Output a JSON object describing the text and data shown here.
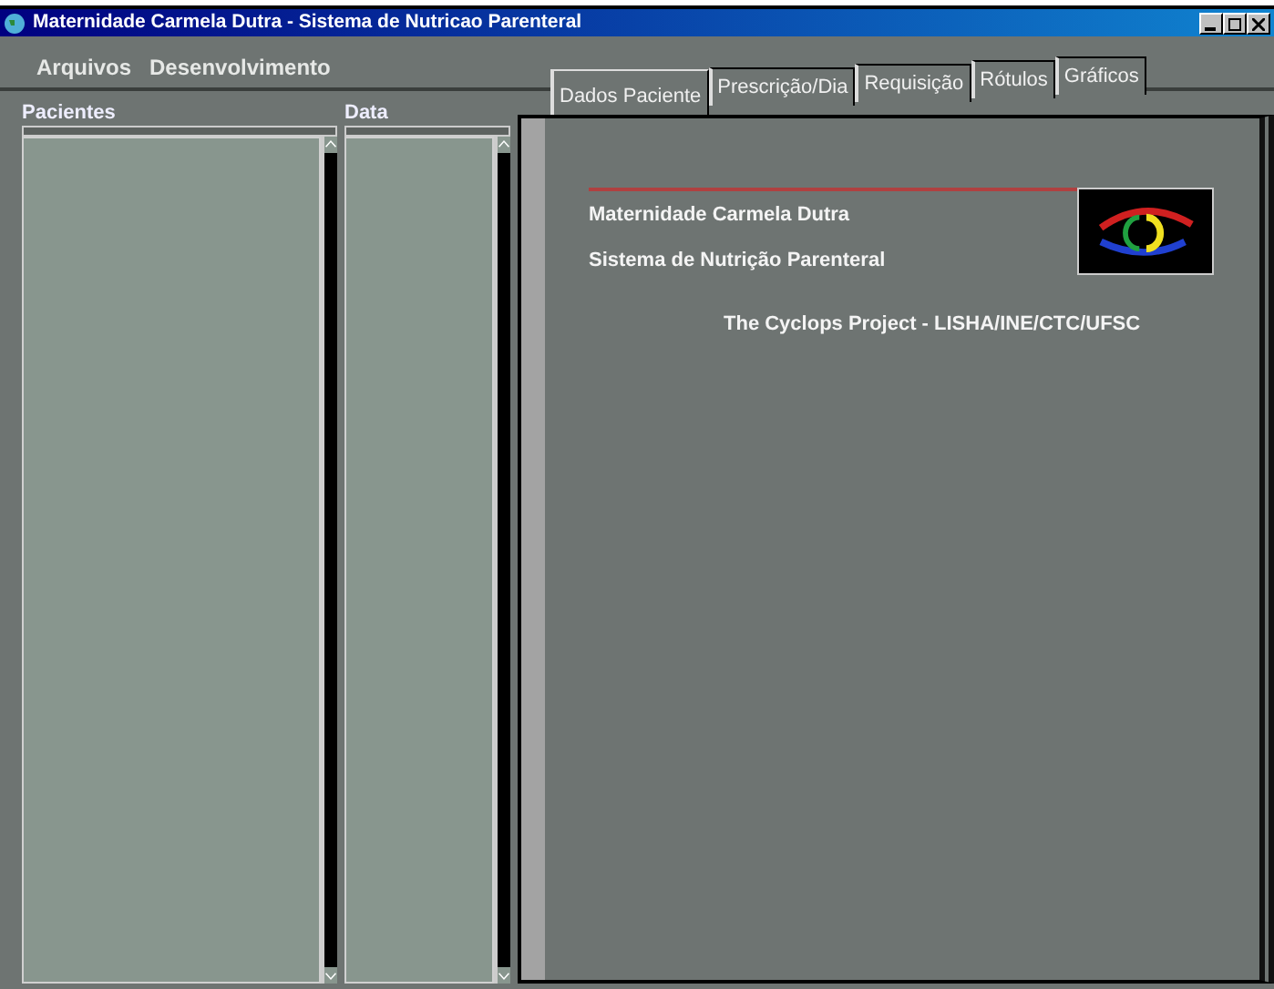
{
  "window": {
    "title": "Maternidade Carmela Dutra - Sistema de Nutricao Parenteral"
  },
  "menu": [
    "Arquivos",
    "Desenvolvimento"
  ],
  "lists": [
    {
      "label": "Pacientes"
    },
    {
      "label": "Data"
    }
  ],
  "tabs": [
    {
      "label": "Dados Paciente",
      "selected": true
    },
    {
      "label": "Prescrição/Dia",
      "selected": false
    },
    {
      "label": "Requisição",
      "selected": false
    },
    {
      "label": "Rótulos",
      "selected": false
    },
    {
      "label": "Gráficos",
      "selected": false
    }
  ],
  "panel": {
    "line_1": "Maternidade Carmela Dutra",
    "line_2": "Sistema de Nutrição Parenteral",
    "credit": "The Cyclops Project - LISHA/INE/CTC/UFSC"
  }
}
